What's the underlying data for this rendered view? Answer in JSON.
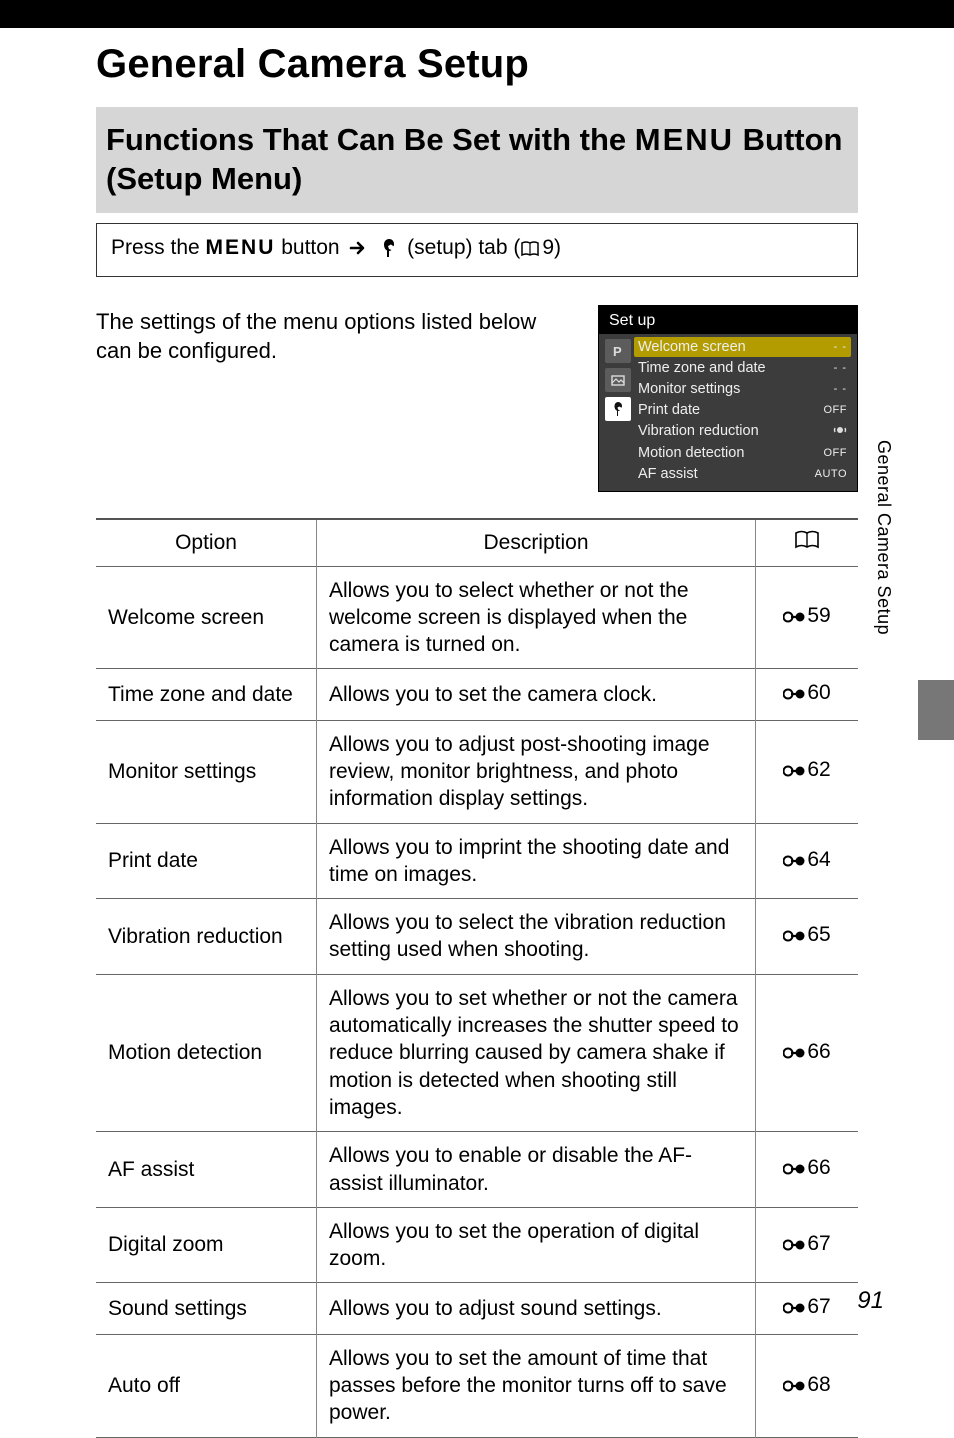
{
  "title": "General Camera Setup",
  "subtitle_pre": "Functions That Can Be Set with the ",
  "subtitle_menu": "MENU",
  "subtitle_post": " Button (Setup Menu)",
  "press_box": {
    "pre": "Press the ",
    "menu": "MENU",
    "mid": " button ",
    "setup_tab": " (setup) tab (",
    "ref_num": "9",
    "end": ")"
  },
  "intro_text": "The settings of the menu options listed below can be configured.",
  "lcd": {
    "title": "Set up",
    "rows": [
      {
        "label": "Welcome screen",
        "value": "- -",
        "dashes": true,
        "hl": true
      },
      {
        "label": "Time zone and date",
        "value": "- -",
        "dashes": true
      },
      {
        "label": "Monitor settings",
        "value": "- -",
        "dashes": true
      },
      {
        "label": "Print date",
        "value": "OFF"
      },
      {
        "label": "Vibration reduction",
        "value": "(●)",
        "icon": true
      },
      {
        "label": "Motion detection",
        "value": "OFF"
      },
      {
        "label": "AF assist",
        "value": "AUTO"
      }
    ]
  },
  "table": {
    "headers": {
      "option": "Option",
      "description": "Description"
    },
    "rows": [
      {
        "option": "Welcome screen",
        "desc": "Allows you to select whether or not the welcome screen is displayed when the camera is turned on.",
        "ref": "59"
      },
      {
        "option": "Time zone and date",
        "desc": "Allows you to set the camera clock.",
        "ref": "60"
      },
      {
        "option": "Monitor settings",
        "desc": "Allows you to adjust post-shooting image review, monitor brightness, and photo information display settings.",
        "ref": "62"
      },
      {
        "option": "Print date",
        "desc": "Allows you to imprint the shooting date and time on images.",
        "ref": "64"
      },
      {
        "option": "Vibration reduction",
        "desc": "Allows you to select the vibration reduction setting used when shooting.",
        "ref": "65"
      },
      {
        "option": "Motion detection",
        "desc": "Allows you to set whether or not the camera automatically increases the shutter speed to reduce blurring caused by camera shake if motion is detected when shooting still images.",
        "ref": "66"
      },
      {
        "option": "AF assist",
        "desc": "Allows you to enable or disable the AF-assist illuminator.",
        "ref": "66"
      },
      {
        "option": "Digital zoom",
        "desc": "Allows you to set the operation of digital zoom.",
        "ref": "67"
      },
      {
        "option": "Sound settings",
        "desc": "Allows you to adjust sound settings.",
        "ref": "67"
      },
      {
        "option": "Auto off",
        "desc": "Allows you to set the amount of time that passes before the monitor turns off to save power.",
        "ref": "68"
      }
    ]
  },
  "side_tab": "General Camera Setup",
  "page_number": "91"
}
